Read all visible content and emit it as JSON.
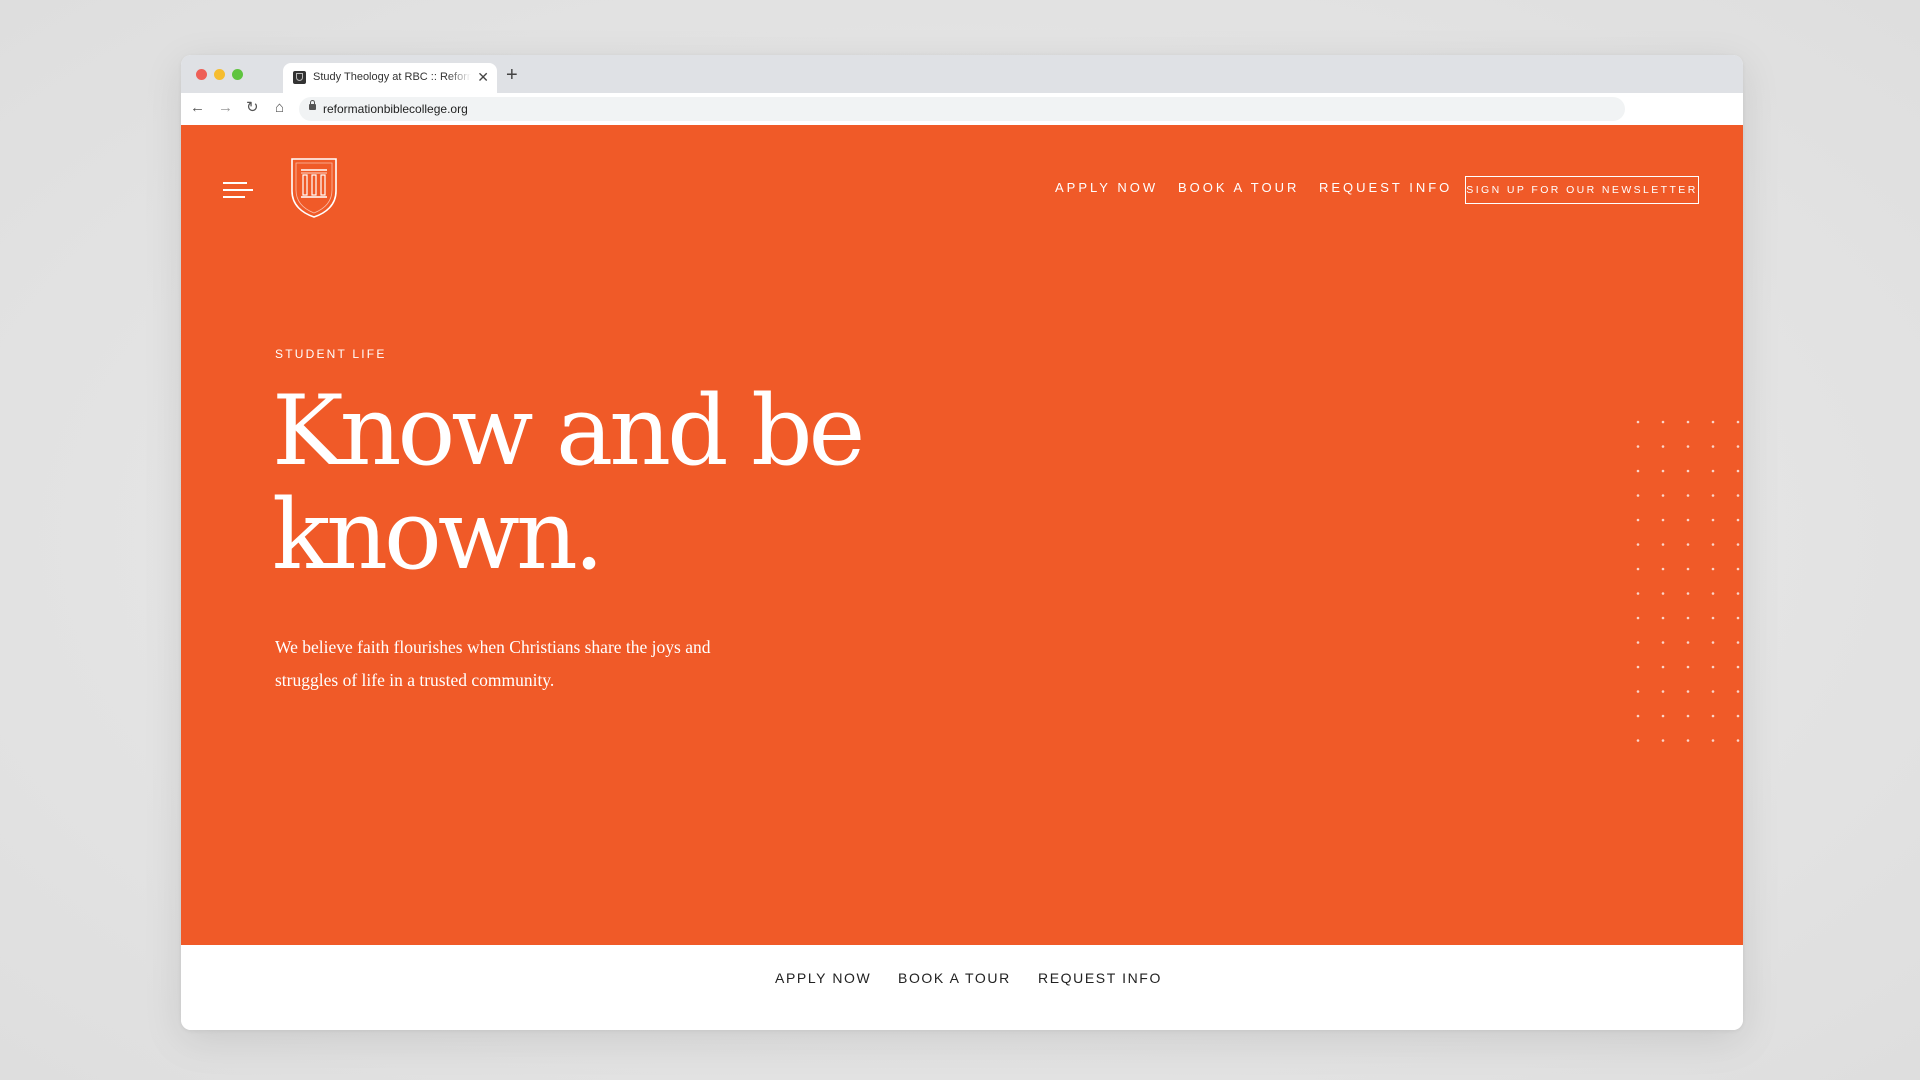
{
  "browser": {
    "tab_title": "Study Theology at RBC :: Reformation Bible College",
    "tab_close": "✕",
    "new_tab": "+",
    "url": "reformationbiblecollege.org",
    "back": "←",
    "forward": "→",
    "reload": "↻",
    "home": "⌂"
  },
  "header": {
    "menu_icon": "hamburger-icon",
    "logo_icon": "shield-pillars-icon",
    "nav": [
      {
        "label": "APPLY NOW"
      },
      {
        "label": "BOOK A TOUR"
      },
      {
        "label": "REQUEST INFO"
      }
    ],
    "newsletter_label": "SIGN UP FOR OUR NEWSLETTER"
  },
  "hero": {
    "eyebrow": "STUDENT LIFE",
    "headline": "Know and be known.",
    "body": "We believe faith flourishes when Christians share the joys and struggles of life in a trusted community."
  },
  "bottom_nav": [
    {
      "label": "APPLY NOW"
    },
    {
      "label": "BOOK A TOUR"
    },
    {
      "label": "REQUEST INFO"
    }
  ],
  "colors": {
    "brand_orange": "#f05a28",
    "text_on_brand": "#ffffff",
    "bottom_bar_bg": "#ffffff",
    "bottom_text": "#222222"
  }
}
